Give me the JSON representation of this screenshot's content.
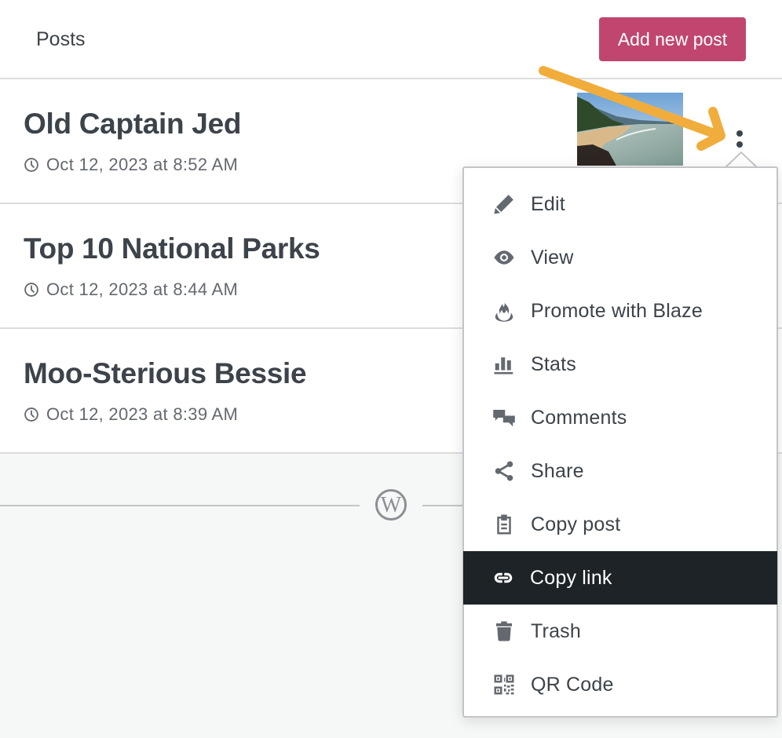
{
  "header": {
    "title": "Posts",
    "add_button_label": "Add new post",
    "accent_color": "#c0466f"
  },
  "posts": [
    {
      "title": "Old Captain Jed",
      "date": "Oct 12, 2023 at 8:52 AM",
      "has_thumbnail": true,
      "thumbnail": "beach-landscape"
    },
    {
      "title": "Top 10 National Parks",
      "date": "Oct 12, 2023 at 8:44 AM",
      "has_thumbnail": false
    },
    {
      "title": "Moo-Sterious Bessie",
      "date": "Oct 12, 2023 at 8:39 AM",
      "has_thumbnail": false
    }
  ],
  "post_menu": {
    "items": [
      {
        "label": "Edit",
        "icon": "pencil-icon"
      },
      {
        "label": "View",
        "icon": "eye-icon"
      },
      {
        "label": "Promote with Blaze",
        "icon": "flame-icon"
      },
      {
        "label": "Stats",
        "icon": "bar-chart-icon"
      },
      {
        "label": "Comments",
        "icon": "comments-icon"
      },
      {
        "label": "Share",
        "icon": "share-icon"
      },
      {
        "label": "Copy post",
        "icon": "clipboard-icon"
      },
      {
        "label": "Copy link",
        "icon": "link-icon",
        "highlighted": true
      },
      {
        "label": "Trash",
        "icon": "trash-icon"
      },
      {
        "label": "QR Code",
        "icon": "qr-code-icon"
      }
    ],
    "highlight_color": "#1d2327"
  },
  "annotation": {
    "type": "arrow",
    "color": "#f0ad3c",
    "points_to": "post-actions-menu-button"
  },
  "footer": {
    "logo": "wordpress-logo"
  }
}
